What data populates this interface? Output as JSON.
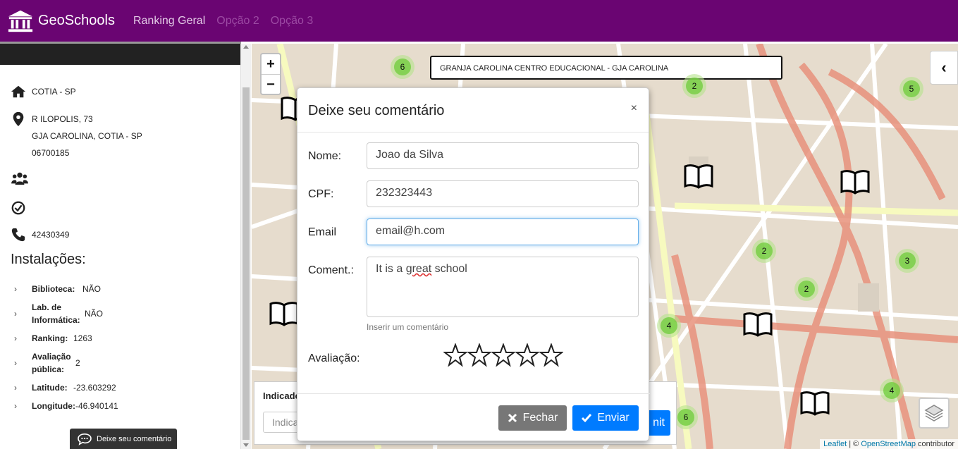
{
  "navbar": {
    "brand": "GeoSchools",
    "links": [
      "Ranking Geral",
      "Opção 2",
      "Opção 3"
    ]
  },
  "sidebar": {
    "city": "COTIA - SP",
    "address_line1": "R ILOPOLIS, 73",
    "address_line2": "GJA CAROLINA, COTIA - SP",
    "address_line3": "06700185",
    "phone": "42430349",
    "section_title": "Instalações:",
    "facilities": [
      {
        "label": "Biblioteca:",
        "value": "NÃO"
      },
      {
        "label": "Lab. de Informática:",
        "value": "NÃO"
      },
      {
        "label": "Ranking:",
        "value": "1263"
      },
      {
        "label": "Avaliação pública:",
        "value": "2"
      },
      {
        "label": "Latitude:",
        "value": "-23.603292"
      },
      {
        "label": "Longitude:",
        "value": "-46.940141"
      }
    ],
    "comment_button": "Deixe seu comentário"
  },
  "map": {
    "school_name": "GRANJA CAROLINA CENTRO EDUCACIONAL - GJA CAROLINA",
    "zoom_in": "+",
    "zoom_out": "−",
    "clusters": [
      "6",
      "2",
      "5",
      "2",
      "2",
      "3",
      "4",
      "4",
      "6"
    ],
    "attribution_leaflet": "Leaflet",
    "attribution_sep": " | © ",
    "attribution_osm": "OpenStreetMap",
    "attribution_tail": " contributor",
    "indicator_label": "Indicado",
    "indicator_placeholder": "Indica",
    "submit_partial": "nit"
  },
  "modal": {
    "title": "Deixe seu comentário",
    "close_symbol": "×",
    "name_label": "Nome:",
    "name_value": "Joao da Silva",
    "cpf_label": "CPF:",
    "cpf_value": "232323443",
    "email_label": "Email",
    "email_value": "email@h.com",
    "comment_label": "Coment.:",
    "comment_value_a": "It is a ",
    "comment_value_b": "great",
    "comment_value_c": " school",
    "comment_help": "Inserir um comentário",
    "rating_label": "Avaliação:",
    "close_button": "Fechar",
    "send_button": "Enviar"
  },
  "colors": {
    "navbar": "#6a0572",
    "primary": "#007bff",
    "secondary": "#777777",
    "cluster": "#6ecc39"
  }
}
